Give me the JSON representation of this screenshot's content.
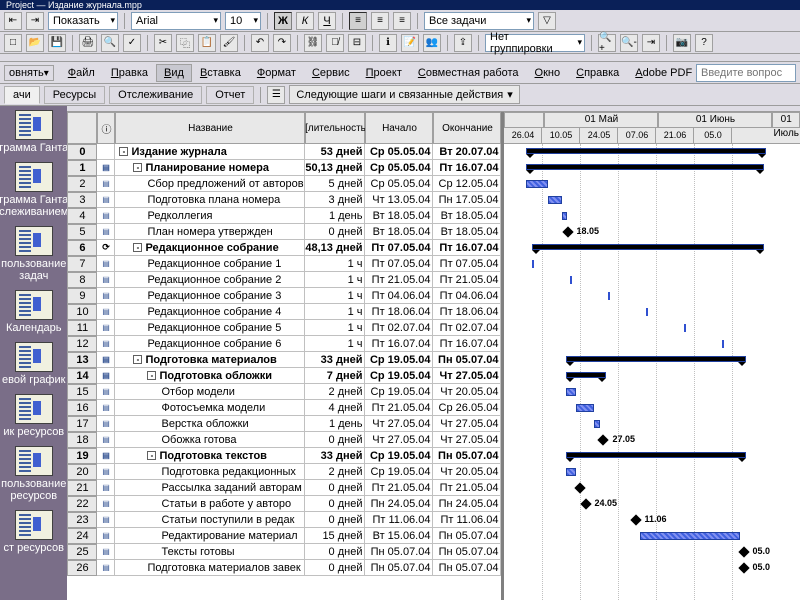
{
  "title": "Project — Издание журнала.mpp",
  "toolbar1": {
    "show_label": "Показать",
    "font": "Arial",
    "size": "10",
    "tasks_filter": "Все задачи"
  },
  "toolbar2": {
    "fit_label": "овнять",
    "group_label": "Нет группировки"
  },
  "menu": [
    "Файл",
    "Правка",
    "Вид",
    "Вставка",
    "Формат",
    "Сервис",
    "Проект",
    "Совместная работа",
    "Окно",
    "Справка",
    "Adobe PDF"
  ],
  "question_placeholder": "Введите вопрос",
  "tabs": {
    "items": [
      "ачи",
      "Ресурсы",
      "Отслеживание",
      "Отчет"
    ],
    "steps_label": "Следующие шаги и связанные действия"
  },
  "sidebar": [
    "грамма Ганта",
    "грамма Ганта слеживанием",
    "пользование задач",
    "Календарь",
    "евой график",
    "ик ресурсов",
    "пользование ресурсов",
    "ст ресурсов"
  ],
  "columns": {
    "name": "Название",
    "duration": "[лительность",
    "start": "Начало",
    "end": "Окончание"
  },
  "timescale_top": [
    "01 Май",
    "01 Июнь",
    "01 Июль"
  ],
  "timescale_bot": [
    "26.04",
    "10.05",
    "24.05",
    "07.06",
    "21.06",
    "05.0"
  ],
  "rows": [
    {
      "n": "0",
      "b": 1,
      "ind": 0,
      "name": "Издание журнала",
      "dur": "53 дней",
      "s": "Ср 05.05.04",
      "e": "Вт 20.07.04",
      "out": "-"
    },
    {
      "n": "1",
      "b": 1,
      "ind": 1,
      "name": "Планирование номера",
      "dur": "50,13 дней",
      "s": "Ср 05.05.04",
      "e": "Пт 16.07.04",
      "out": "-"
    },
    {
      "n": "2",
      "b": 0,
      "ind": 2,
      "name": "Сбор предложений от авторов",
      "dur": "5 дней",
      "s": "Ср 05.05.04",
      "e": "Ср 12.05.04"
    },
    {
      "n": "3",
      "b": 0,
      "ind": 2,
      "name": "Подготовка плана номера",
      "dur": "3 дней",
      "s": "Чт 13.05.04",
      "e": "Пн 17.05.04"
    },
    {
      "n": "4",
      "b": 0,
      "ind": 2,
      "name": "Редколлегия",
      "dur": "1 день",
      "s": "Вт 18.05.04",
      "e": "Вт 18.05.04"
    },
    {
      "n": "5",
      "b": 0,
      "ind": 2,
      "name": "План номера утвержден",
      "dur": "0 дней",
      "s": "Вт 18.05.04",
      "e": "Вт 18.05.04"
    },
    {
      "n": "6",
      "b": 1,
      "ind": 1,
      "name": "Редакционное собрание",
      "dur": "48,13 дней",
      "s": "Пт 07.05.04",
      "e": "Пт 16.07.04",
      "out": "-",
      "rec": 1
    },
    {
      "n": "7",
      "b": 0,
      "ind": 2,
      "name": "Редакционное собрание 1",
      "dur": "1 ч",
      "s": "Пт 07.05.04",
      "e": "Пт 07.05.04"
    },
    {
      "n": "8",
      "b": 0,
      "ind": 2,
      "name": "Редакционное собрание 2",
      "dur": "1 ч",
      "s": "Пт 21.05.04",
      "e": "Пт 21.05.04"
    },
    {
      "n": "9",
      "b": 0,
      "ind": 2,
      "name": "Редакционное собрание 3",
      "dur": "1 ч",
      "s": "Пт 04.06.04",
      "e": "Пт 04.06.04"
    },
    {
      "n": "10",
      "b": 0,
      "ind": 2,
      "name": "Редакционное собрание 4",
      "dur": "1 ч",
      "s": "Пт 18.06.04",
      "e": "Пт 18.06.04"
    },
    {
      "n": "11",
      "b": 0,
      "ind": 2,
      "name": "Редакционное собрание 5",
      "dur": "1 ч",
      "s": "Пт 02.07.04",
      "e": "Пт 02.07.04"
    },
    {
      "n": "12",
      "b": 0,
      "ind": 2,
      "name": "Редакционное собрание 6",
      "dur": "1 ч",
      "s": "Пт 16.07.04",
      "e": "Пт 16.07.04"
    },
    {
      "n": "13",
      "b": 1,
      "ind": 1,
      "name": "Подготовка материалов",
      "dur": "33 дней",
      "s": "Ср 19.05.04",
      "e": "Пн 05.07.04",
      "out": "-"
    },
    {
      "n": "14",
      "b": 1,
      "ind": 2,
      "name": "Подготовка обложки",
      "dur": "7 дней",
      "s": "Ср 19.05.04",
      "e": "Чт 27.05.04",
      "out": "-"
    },
    {
      "n": "15",
      "b": 0,
      "ind": 3,
      "name": "Отбор модели",
      "dur": "2 дней",
      "s": "Ср 19.05.04",
      "e": "Чт 20.05.04"
    },
    {
      "n": "16",
      "b": 0,
      "ind": 3,
      "name": "Фотосъемка модели",
      "dur": "4 дней",
      "s": "Пт 21.05.04",
      "e": "Ср 26.05.04"
    },
    {
      "n": "17",
      "b": 0,
      "ind": 3,
      "name": "Верстка обложки",
      "dur": "1 день",
      "s": "Чт 27.05.04",
      "e": "Чт 27.05.04"
    },
    {
      "n": "18",
      "b": 0,
      "ind": 3,
      "name": "Обожка готова",
      "dur": "0 дней",
      "s": "Чт 27.05.04",
      "e": "Чт 27.05.04"
    },
    {
      "n": "19",
      "b": 1,
      "ind": 2,
      "name": "Подготовка текстов",
      "dur": "33 дней",
      "s": "Ср 19.05.04",
      "e": "Пн 05.07.04",
      "out": "-"
    },
    {
      "n": "20",
      "b": 0,
      "ind": 3,
      "name": "Подготовка редакционных",
      "dur": "2 дней",
      "s": "Ср 19.05.04",
      "e": "Чт 20.05.04"
    },
    {
      "n": "21",
      "b": 0,
      "ind": 3,
      "name": "Рассылка заданий авторам",
      "dur": "0 дней",
      "s": "Пт 21.05.04",
      "e": "Пт 21.05.04"
    },
    {
      "n": "22",
      "b": 0,
      "ind": 3,
      "name": "Статьи в работе у авторо",
      "dur": "0 дней",
      "s": "Пн 24.05.04",
      "e": "Пн 24.05.04"
    },
    {
      "n": "23",
      "b": 0,
      "ind": 3,
      "name": "Статьи поступили в редак",
      "dur": "0 дней",
      "s": "Пт 11.06.04",
      "e": "Пт 11.06.04"
    },
    {
      "n": "24",
      "b": 0,
      "ind": 3,
      "name": "Редактирование материал",
      "dur": "15 дней",
      "s": "Вт 15.06.04",
      "e": "Пн 05.07.04"
    },
    {
      "n": "25",
      "b": 0,
      "ind": 3,
      "name": "Тексты готовы",
      "dur": "0 дней",
      "s": "Пн 05.07.04",
      "e": "Пн 05.07.04"
    },
    {
      "n": "26",
      "b": 0,
      "ind": 2,
      "name": "Подготовка материалов завек",
      "dur": "0 дней",
      "s": "Пн 05.07.04",
      "e": "Пн 05.07.04"
    }
  ],
  "gantt_labels": {
    "r5": "18.05",
    "r18": "27.05",
    "r22": "24.05",
    "r23": "11.06",
    "r25": "05.0",
    "r26": "05.0"
  }
}
